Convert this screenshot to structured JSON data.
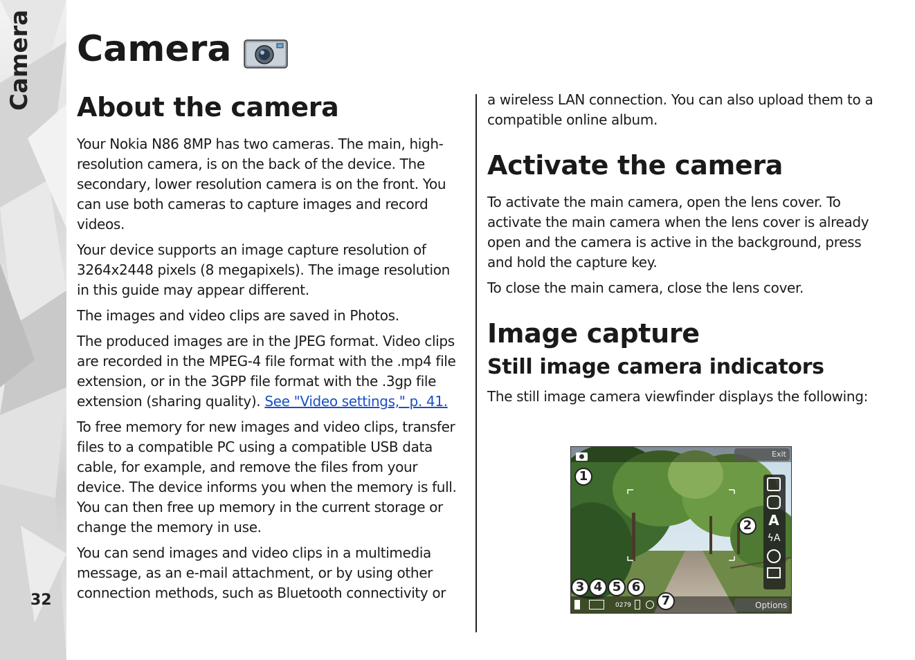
{
  "sidebar": {
    "label": "Camera",
    "page_number": "32"
  },
  "page_title": "Camera",
  "left_column": {
    "heading": "About the camera",
    "paragraphs": [
      "Your Nokia N86 8MP has two cameras. The main, high-resolution camera, is on the back of the device. The secondary, lower resolution camera is on the front. You can use both cameras to capture images and record videos.",
      "Your device supports an image capture resolution of 3264x2448 pixels (8 megapixels). The image resolution in this guide may appear different.",
      "The images and video clips are saved in Photos.",
      "To free memory for new images and video clips, transfer files to a compatible PC using a compatible USB data cable, for example, and remove the files from your device. The device informs you when the memory is full. You can then free up memory in the current storage or change the memory in use.",
      "You can send images and video clips in a multimedia message, as an e-mail attachment, or by using other connection methods, such as Bluetooth connectivity or"
    ],
    "format_paragraph": "The produced images are in the JPEG format. Video clips are recorded in the MPEG-4 file format with the .mp4 file extension, or in the 3GPP file format with the .3gp file extension (sharing quality).",
    "format_link": "See \"Video settings,\" p. 41."
  },
  "right_column": {
    "continuation": "a wireless LAN connection. You can also upload them to a compatible online album.",
    "activate_heading": "Activate the camera",
    "activate_paragraphs": [
      "To activate the main camera, open the lens cover. To activate the main camera when the lens cover is already open and the camera is active in the background, press and hold the capture key.",
      "To close the main camera, close the lens cover."
    ],
    "capture_heading": "Image capture",
    "indicators_heading": "Still image camera indicators",
    "indicators_intro": "The still image camera viewfinder displays the following:"
  },
  "viewfinder": {
    "exit_label": "Exit",
    "options_label": "Options",
    "counter": "0279",
    "callouts": [
      "1",
      "2",
      "3",
      "4",
      "5",
      "6",
      "7"
    ],
    "toolbar_icons": [
      "capture-mode-icon",
      "video-mode-icon",
      "scene-auto-icon",
      "flash-auto-icon",
      "self-timer-icon",
      "frame-icon"
    ]
  }
}
